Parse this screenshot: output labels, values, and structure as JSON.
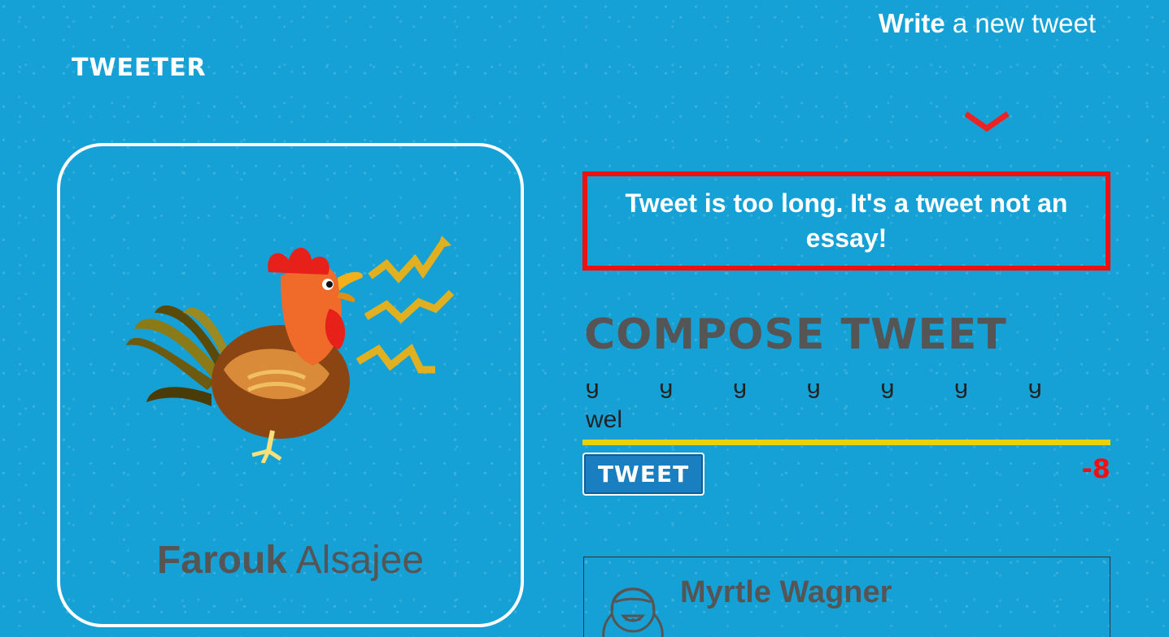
{
  "nav": {
    "write_bold": "Write",
    "write_rest": " a new tweet"
  },
  "brand": {
    "name": "Tweeter"
  },
  "profile": {
    "first_name": "Farouk",
    "last_name": " Alsajee",
    "avatar_icon": "rooster-icon"
  },
  "compose": {
    "error_message": "Tweet is too long. It's a tweet not an essay!",
    "title": "Compose Tweet",
    "text_prev_line": "ggggggg",
    "text_value": "wel",
    "submit_label": "Tweet",
    "counter": "-8",
    "underline_color": "#e8d20a",
    "error_color": "#ee1111"
  },
  "feed": {
    "tweets": [
      {
        "author": "Myrtle Wagner",
        "avatar_icon": "user-avatar-icon"
      }
    ]
  },
  "colors": {
    "background": "#16a1d6",
    "text_dark": "#555555",
    "accent_red": "#ee1111"
  }
}
